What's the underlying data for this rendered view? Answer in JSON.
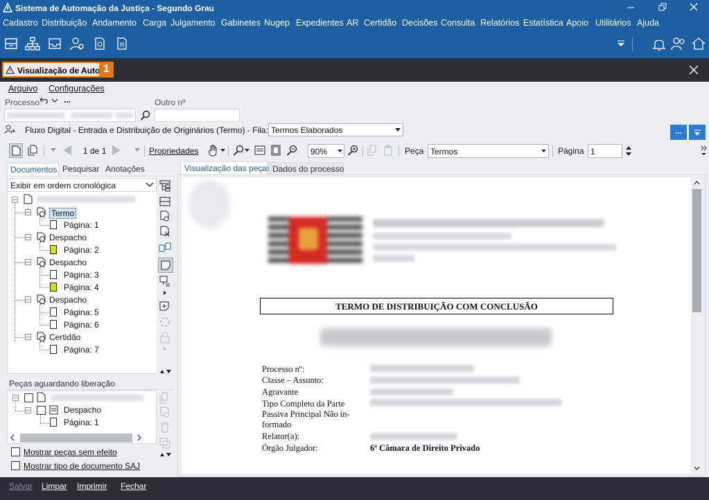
{
  "window": {
    "title": "Sistema de Automação da Justiça - Segundo Grau"
  },
  "menu": [
    "Cadastro",
    "Distribuição",
    "Andamento",
    "Carga",
    "Julgamento",
    "Gabinetes",
    "Nugep",
    "Expedientes",
    "AR",
    "Certidão",
    "Decisões",
    "Consulta",
    "Relatórios",
    "Estatística",
    "Apoio",
    "Utilitários",
    "Ajuda"
  ],
  "tab": {
    "label": "Visualização de Autos",
    "badge": "1"
  },
  "submenu": {
    "arquivo": "Arquivo",
    "config": "Configurações",
    "more": "..."
  },
  "fields": {
    "processo_label": "Processo",
    "outro_label": "Outro nº"
  },
  "flow": {
    "text": "Fluxo Digital - Entrada e Distribuição de Originários (Termo) - Fila:",
    "fila": "Termos Elaborados",
    "more_btn": "..."
  },
  "viewer": {
    "page_info": "1 de 1",
    "propriedades": "Propriedades",
    "zoom": "90%",
    "peca_label": "Peça",
    "peca_value": "Termos",
    "pagina_label": "Página",
    "pagina_value": "1"
  },
  "left_tabs": {
    "documentos": "Documentos",
    "pesquisar": "Pesquisar",
    "anotacoes": "Anotações"
  },
  "order_select": "Exibir em ordem cronológica",
  "tree": [
    {
      "label": "Termo",
      "selected": true,
      "pages": [
        {
          "label": "Página: 1",
          "highlight": false
        }
      ]
    },
    {
      "label": "Despacho",
      "pages": [
        {
          "label": "Página: 2",
          "highlight": true
        }
      ]
    },
    {
      "label": "Despacho",
      "pages": [
        {
          "label": "Página: 3",
          "highlight": false
        },
        {
          "label": "Página: 4",
          "highlight": true
        }
      ]
    },
    {
      "label": "Despacho",
      "pages": [
        {
          "label": "Página: 5",
          "highlight": false
        },
        {
          "label": "Página: 6",
          "highlight": false
        }
      ]
    },
    {
      "label": "Certidão",
      "pages": [
        {
          "label": "Página: 7",
          "highlight": false
        }
      ]
    }
  ],
  "pending": {
    "title": "Peças aguardando liberação",
    "doc": "Despacho",
    "page": "Página: 1"
  },
  "options": {
    "sem_efeito": "Mostrar peças sem efeito",
    "tipo_saj": "Mostrar tipo de documento SAJ"
  },
  "right_tabs": {
    "visualizacao": "Visualização das peças",
    "dados": "Dados do processo"
  },
  "document": {
    "heading": "TERMO DE DISTRIBUIÇÃO COM CONCLUSÃO",
    "rows": [
      {
        "label": "Processo nº:",
        "value": ""
      },
      {
        "label": "Classe – Assunto:",
        "value": ""
      },
      {
        "label": "Agravante",
        "value": ""
      },
      {
        "label": "Tipo Completo da Parte",
        "value": ""
      },
      {
        "label": "Passiva Principal Não in-",
        "value": ""
      },
      {
        "label": "formado",
        "value": ""
      },
      {
        "label": "Relator(a):",
        "value": ""
      },
      {
        "label": "Órgão Julgador:",
        "value": "6ª Câmara de Direito Privado"
      }
    ]
  },
  "bottom": {
    "salvar": "Salvar",
    "limpar": "Limpar",
    "imprimir": "Imprimir",
    "fechar": "Fechar"
  },
  "colors": {
    "title_bar": "#1c5fa3",
    "dark_bar": "#2b2f35",
    "accent": "#e07b16",
    "link": "#1c5fa3"
  }
}
